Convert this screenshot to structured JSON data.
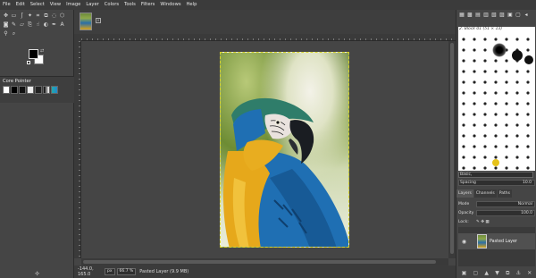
{
  "menu": [
    "File",
    "Edit",
    "Select",
    "View",
    "Image",
    "Layer",
    "Colors",
    "Tools",
    "Filters",
    "Windows",
    "Help"
  ],
  "tool_options": {
    "title": "Core Pointer"
  },
  "canvas": {
    "photo_subject": "blue-and-yellow macaw",
    "colors": {
      "blue": "#1f6fb3",
      "yellow": "#e6a81b",
      "selection": "#d7d32a"
    }
  },
  "status": {
    "coords": "-144.0, 165.0",
    "unit": "px",
    "zoom": "66.7 %",
    "message": "Pasted Layer (9.9 MB)"
  },
  "brushes": {
    "name": "2. Block 01 (51 × 13)",
    "selected": "Basic,",
    "spacing_label": "Spacing",
    "spacing_value": "10.0"
  },
  "layers": {
    "tabs": [
      "Layers",
      "Channels",
      "Paths"
    ],
    "mode_label": "Mode",
    "mode_value": "Normal",
    "opacity_label": "Opacity",
    "opacity_value": "100.0",
    "lock_label": "Lock:",
    "items": [
      {
        "name": "Pasted Layer"
      }
    ]
  }
}
